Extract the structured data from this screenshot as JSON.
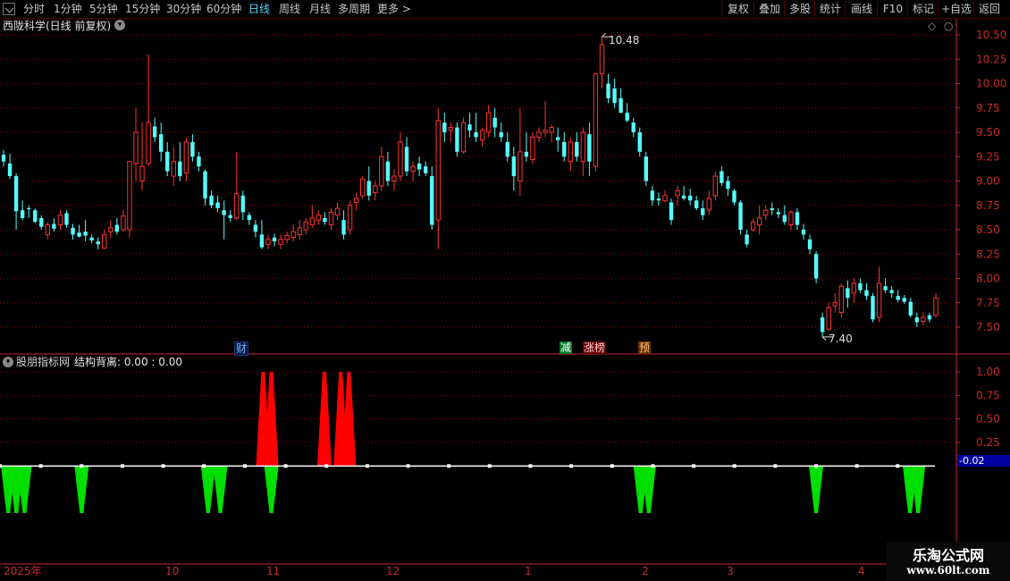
{
  "toolbar": {
    "periods": [
      "分时",
      "1分钟",
      "5分钟",
      "15分钟",
      "30分钟",
      "60分钟",
      "日线",
      "周线",
      "月线",
      "多周期",
      "更多 >"
    ],
    "active_period": "日线",
    "right_buttons": [
      "复权",
      "叠加",
      "多股",
      "统计",
      "画线",
      "F10",
      "标记",
      "+自选",
      "返回"
    ]
  },
  "main_panel": {
    "title": "西陇科学(日线 前复权)",
    "high_marker": "10.48",
    "low_marker": "7.40",
    "events": [
      "财",
      "减",
      "涨榜",
      "预"
    ]
  },
  "indicator_panel": {
    "source": "股朋指标网",
    "name": "结构背离: 0.00 : 0.00",
    "current_value": "-0.02"
  },
  "date_axis": [
    "2025年",
    "10",
    "11",
    "12",
    "1",
    "2",
    "3",
    "4"
  ],
  "watermark": {
    "line1": "乐淘公式网",
    "line2": "www.60lt.com"
  },
  "colors": {
    "up": "#ff3232",
    "down": "#54ffff",
    "bull_signal": "#ff0000",
    "bear_signal": "#00e000",
    "grid": "#8b0000",
    "axis": "#c82828"
  },
  "chart_data": [
    {
      "type": "candlestick",
      "title": "西陇科学(日线 前复权)",
      "y_ticks": [
        10.5,
        10.25,
        10.0,
        9.75,
        9.5,
        9.25,
        9.0,
        8.75,
        8.5,
        8.25,
        8.0,
        7.75,
        7.5
      ],
      "ylim": [
        7.33,
        10.75
      ],
      "x_ticks": [
        "2025年",
        "10",
        "11",
        "12",
        "1",
        "2",
        "3",
        "4"
      ],
      "series": [
        {
          "values": [
            [
              9.27,
              9.32,
              9.15,
              9.2
            ],
            [
              9.18,
              9.28,
              9.02,
              9.05
            ],
            [
              9.05,
              9.08,
              8.5,
              8.69
            ],
            [
              8.7,
              8.8,
              8.6,
              8.62
            ],
            [
              8.72,
              8.75,
              8.62,
              8.71
            ],
            [
              8.7,
              8.72,
              8.57,
              8.58
            ],
            [
              8.62,
              8.65,
              8.5,
              8.53
            ],
            [
              8.45,
              8.58,
              8.4,
              8.55
            ],
            [
              8.56,
              8.62,
              8.48,
              8.51
            ],
            [
              8.55,
              8.7,
              8.5,
              8.65
            ],
            [
              8.67,
              8.7,
              8.52,
              8.55
            ],
            [
              8.52,
              8.56,
              8.4,
              8.45
            ],
            [
              8.47,
              8.55,
              8.42,
              8.43
            ],
            [
              8.48,
              8.6,
              8.38,
              8.44
            ],
            [
              8.42,
              8.45,
              8.36,
              8.39
            ],
            [
              8.38,
              8.42,
              8.3,
              8.35
            ],
            [
              8.31,
              8.5,
              8.3,
              8.45
            ],
            [
              8.48,
              8.6,
              8.42,
              8.52
            ],
            [
              8.55,
              8.62,
              8.45,
              8.48
            ],
            [
              8.5,
              8.7,
              8.48,
              8.64
            ],
            [
              8.5,
              9.15,
              8.42,
              9.2
            ],
            [
              9.18,
              9.75,
              9.0,
              9.5
            ],
            [
              9.0,
              9.6,
              8.9,
              9.15
            ],
            [
              9.18,
              10.3,
              9.15,
              9.6
            ],
            [
              9.56,
              9.65,
              9.4,
              9.45
            ],
            [
              9.48,
              9.6,
              9.2,
              9.3
            ],
            [
              9.3,
              9.4,
              9.05,
              9.1
            ],
            [
              9.05,
              9.35,
              8.95,
              9.2
            ],
            [
              9.2,
              9.4,
              9.0,
              9.05
            ],
            [
              9.08,
              9.45,
              9.0,
              9.4
            ],
            [
              9.4,
              9.48,
              9.2,
              9.25
            ],
            [
              9.25,
              9.3,
              9.1,
              9.15
            ],
            [
              9.1,
              9.12,
              8.75,
              8.82
            ],
            [
              8.85,
              8.9,
              8.72,
              8.75
            ],
            [
              8.78,
              8.85,
              8.68,
              8.72
            ],
            [
              8.7,
              8.8,
              8.4,
              8.65
            ],
            [
              8.65,
              8.7,
              8.58,
              8.62
            ],
            [
              8.62,
              9.3,
              8.6,
              8.87
            ],
            [
              8.85,
              8.9,
              8.6,
              8.68
            ],
            [
              8.65,
              8.68,
              8.55,
              8.6
            ],
            [
              8.55,
              8.6,
              8.42,
              8.48
            ],
            [
              8.45,
              8.6,
              8.3,
              8.32
            ],
            [
              8.35,
              8.45,
              8.3,
              8.4
            ],
            [
              8.42,
              8.46,
              8.33,
              8.38
            ],
            [
              8.35,
              8.45,
              8.3,
              8.4
            ],
            [
              8.4,
              8.48,
              8.36,
              8.44
            ],
            [
              8.42,
              8.55,
              8.38,
              8.48
            ],
            [
              8.45,
              8.6,
              8.4,
              8.52
            ],
            [
              8.5,
              8.62,
              8.45,
              8.58
            ],
            [
              8.55,
              8.75,
              8.52,
              8.62
            ],
            [
              8.6,
              8.7,
              8.55,
              8.65
            ],
            [
              8.62,
              8.68,
              8.55,
              8.58
            ],
            [
              8.55,
              8.72,
              8.5,
              8.68
            ],
            [
              8.65,
              8.78,
              8.6,
              8.72
            ],
            [
              8.6,
              8.7,
              8.4,
              8.45
            ],
            [
              8.5,
              8.8,
              8.45,
              8.75
            ],
            [
              8.78,
              8.88,
              8.7,
              8.82
            ],
            [
              8.85,
              9.05,
              8.82,
              9.02
            ],
            [
              9.0,
              9.15,
              8.8,
              8.85
            ],
            [
              8.88,
              9.0,
              8.8,
              8.95
            ],
            [
              8.95,
              9.35,
              8.9,
              9.25
            ],
            [
              9.2,
              9.3,
              8.95,
              9.0
            ],
            [
              9.0,
              9.12,
              8.9,
              9.05
            ],
            [
              9.05,
              9.5,
              9.0,
              9.4
            ],
            [
              9.35,
              9.45,
              9.05,
              9.1
            ],
            [
              9.1,
              9.2,
              9.0,
              9.15
            ],
            [
              9.18,
              9.25,
              9.05,
              9.12
            ],
            [
              9.15,
              9.2,
              9.05,
              9.08
            ],
            [
              9.05,
              9.15,
              8.5,
              8.55
            ],
            [
              8.6,
              9.75,
              8.3,
              9.62
            ],
            [
              9.6,
              9.7,
              9.4,
              9.5
            ],
            [
              9.52,
              9.6,
              9.4,
              9.55
            ],
            [
              9.55,
              9.6,
              9.25,
              9.3
            ],
            [
              9.3,
              9.65,
              9.28,
              9.6
            ],
            [
              9.58,
              9.7,
              9.45,
              9.52
            ],
            [
              9.5,
              9.7,
              9.4,
              9.45
            ],
            [
              9.42,
              9.55,
              9.35,
              9.52
            ],
            [
              9.5,
              9.78,
              9.45,
              9.7
            ],
            [
              9.65,
              9.75,
              9.45,
              9.55
            ],
            [
              9.5,
              9.6,
              9.4,
              9.45
            ],
            [
              9.4,
              9.5,
              9.2,
              9.25
            ],
            [
              9.25,
              9.35,
              8.9,
              9.05
            ],
            [
              9.0,
              9.75,
              8.85,
              9.3
            ],
            [
              9.3,
              9.5,
              9.2,
              9.25
            ],
            [
              9.22,
              9.5,
              9.18,
              9.45
            ],
            [
              9.45,
              9.55,
              9.4,
              9.5
            ],
            [
              9.5,
              9.82,
              9.45,
              9.52
            ],
            [
              9.5,
              9.58,
              9.4,
              9.55
            ],
            [
              9.45,
              9.55,
              9.3,
              9.42
            ],
            [
              9.4,
              9.5,
              9.2,
              9.25
            ],
            [
              9.2,
              9.45,
              9.1,
              9.4
            ],
            [
              9.4,
              9.5,
              9.2,
              9.25
            ],
            [
              9.2,
              9.55,
              9.05,
              9.5
            ],
            [
              9.48,
              9.6,
              9.05,
              9.2
            ],
            [
              9.15,
              10.1,
              9.1,
              10.1
            ],
            [
              10.1,
              10.48,
              9.95,
              10.4
            ],
            [
              10.0,
              10.1,
              9.8,
              9.85
            ],
            [
              9.95,
              10.05,
              9.75,
              9.8
            ],
            [
              9.85,
              9.95,
              9.7,
              9.7
            ],
            [
              9.7,
              9.8,
              9.6,
              9.62
            ],
            [
              9.6,
              9.65,
              9.45,
              9.5
            ],
            [
              9.5,
              9.55,
              9.25,
              9.3
            ],
            [
              9.25,
              9.3,
              8.95,
              9.0
            ],
            [
              8.9,
              8.95,
              8.75,
              8.8
            ],
            [
              8.82,
              8.88,
              8.75,
              8.8
            ],
            [
              8.8,
              8.9,
              8.78,
              8.85
            ],
            [
              8.78,
              8.82,
              8.55,
              8.6
            ],
            [
              8.85,
              8.95,
              8.75,
              8.9
            ],
            [
              8.85,
              8.95,
              8.8,
              8.82
            ],
            [
              8.85,
              8.92,
              8.75,
              8.8
            ],
            [
              8.8,
              8.85,
              8.7,
              8.72
            ],
            [
              8.72,
              8.8,
              8.6,
              8.65
            ],
            [
              8.7,
              8.9,
              8.65,
              8.82
            ],
            [
              8.85,
              9.1,
              8.8,
              9.05
            ],
            [
              9.1,
              9.15,
              8.95,
              8.98
            ],
            [
              9.0,
              9.05,
              8.85,
              8.92
            ],
            [
              8.9,
              8.92,
              8.75,
              8.78
            ],
            [
              8.78,
              8.8,
              8.45,
              8.5
            ],
            [
              8.45,
              8.5,
              8.32,
              8.35
            ],
            [
              8.5,
              8.62,
              8.48,
              8.58
            ],
            [
              8.55,
              8.75,
              8.45,
              8.62
            ],
            [
              8.65,
              8.75,
              8.6,
              8.7
            ],
            [
              8.72,
              8.78,
              8.65,
              8.7
            ],
            [
              8.68,
              8.72,
              8.62,
              8.66
            ],
            [
              8.65,
              8.75,
              8.55,
              8.58
            ],
            [
              8.55,
              8.7,
              8.5,
              8.68
            ],
            [
              8.68,
              8.72,
              8.5,
              8.55
            ],
            [
              8.5,
              8.56,
              8.4,
              8.45
            ],
            [
              8.4,
              8.45,
              8.25,
              8.3
            ],
            [
              8.25,
              8.28,
              7.95,
              8.0
            ],
            [
              7.6,
              7.65,
              7.4,
              7.45
            ],
            [
              7.48,
              7.75,
              7.46,
              7.7
            ],
            [
              7.72,
              7.85,
              7.65,
              7.75
            ],
            [
              7.65,
              7.95,
              7.6,
              7.92
            ],
            [
              7.9,
              7.98,
              7.7,
              7.8
            ],
            [
              7.85,
              8.0,
              7.75,
              7.95
            ],
            [
              7.95,
              8.0,
              7.85,
              7.88
            ],
            [
              7.88,
              7.95,
              7.78,
              7.82
            ],
            [
              7.82,
              7.85,
              7.55,
              7.58
            ],
            [
              7.6,
              8.12,
              7.55,
              7.95
            ],
            [
              7.92,
              8.0,
              7.85,
              7.88
            ],
            [
              7.88,
              7.92,
              7.8,
              7.85
            ],
            [
              7.82,
              7.88,
              7.76,
              7.78
            ],
            [
              7.8,
              7.83,
              7.74,
              7.76
            ],
            [
              7.76,
              7.8,
              7.6,
              7.62
            ],
            [
              7.6,
              7.65,
              7.5,
              7.55
            ],
            [
              7.56,
              7.65,
              7.52,
              7.6
            ],
            [
              7.62,
              7.65,
              7.55,
              7.58
            ],
            [
              7.62,
              7.85,
              7.6,
              7.8
            ]
          ]
        }
      ]
    },
    {
      "type": "bar",
      "title": "股朋指标网 结构背离: 0.00 : 0.00",
      "y_ticks": [
        1.0,
        0.75,
        0.5,
        0.25
      ],
      "ylim": [
        -0.63,
        1.03
      ],
      "current_value": -0.02,
      "bull_signals": [
        [
          64.5,
          1.0
        ],
        [
          66.5,
          1.0
        ],
        [
          79.5,
          1.0
        ],
        [
          83.5,
          1.0
        ],
        [
          85.5,
          1.0
        ]
      ],
      "bear_signals": [
        [
          2,
          -0.5
        ],
        [
          4,
          -0.5
        ],
        [
          6,
          -0.5
        ],
        [
          20,
          -0.5
        ],
        [
          51,
          -0.5
        ],
        [
          54,
          -0.5
        ],
        [
          66.5,
          -0.5
        ],
        [
          157,
          -0.5
        ],
        [
          159,
          -0.5
        ],
        [
          200,
          -0.5
        ],
        [
          223,
          -0.5
        ],
        [
          225,
          -0.5
        ]
      ]
    }
  ]
}
